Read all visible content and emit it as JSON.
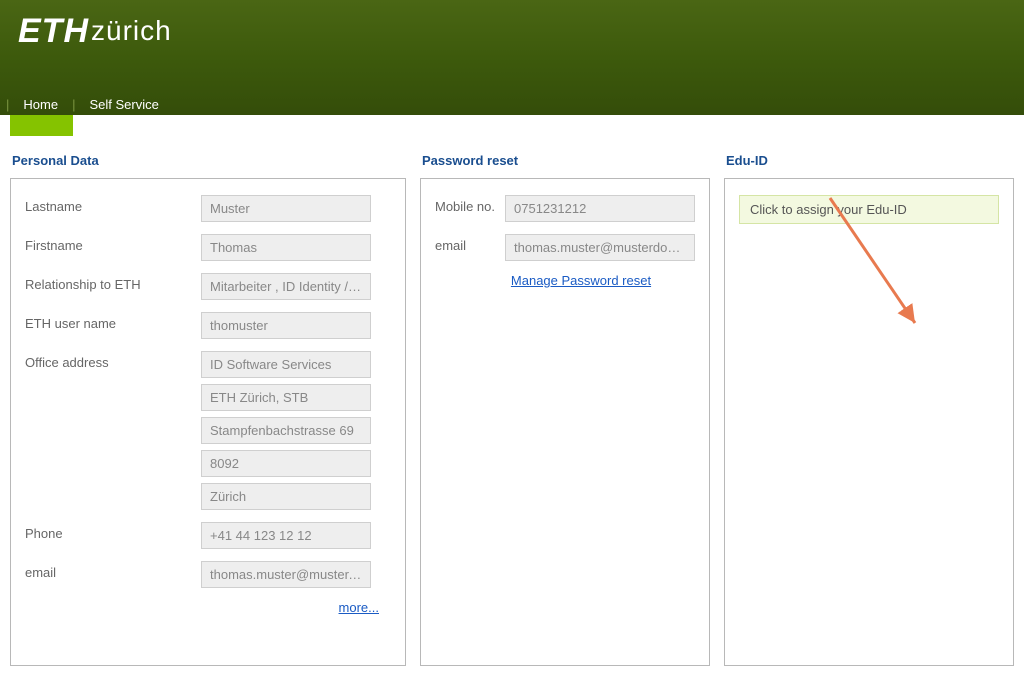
{
  "header": {
    "logo_bold": "ETH",
    "logo_light": "zürich"
  },
  "nav": {
    "home": "Home",
    "self_service": "Self Service"
  },
  "panels": {
    "personal": {
      "title": "Personal Data",
      "labels": {
        "lastname": "Lastname",
        "firstname": "Firstname",
        "relationship": "Relationship to ETH",
        "username": "ETH user name",
        "office": "Office address",
        "phone": "Phone",
        "email": "email"
      },
      "values": {
        "lastname": "Muster",
        "firstname": "Thomas",
        "relationship": "Mitarbeiter , ID Identity / Acc",
        "username": "thomuster",
        "office1": "ID Software Services",
        "office2": "ETH Zürich, STB",
        "office3": "Stampfenbachstrasse 69",
        "office4": "8092",
        "office5": "Zürich",
        "phone": "+41 44 123 12 12",
        "email": "thomas.muster@muster.ethz"
      },
      "more": "more..."
    },
    "password": {
      "title": "Password reset",
      "labels": {
        "mobile": "Mobile no.",
        "email": "email"
      },
      "values": {
        "mobile": "0751231212",
        "email": "thomas.muster@musterdomain"
      },
      "manage": "Manage Password reset"
    },
    "eduid": {
      "title": "Edu-ID",
      "assign": "Click to assign your Edu-ID"
    }
  }
}
